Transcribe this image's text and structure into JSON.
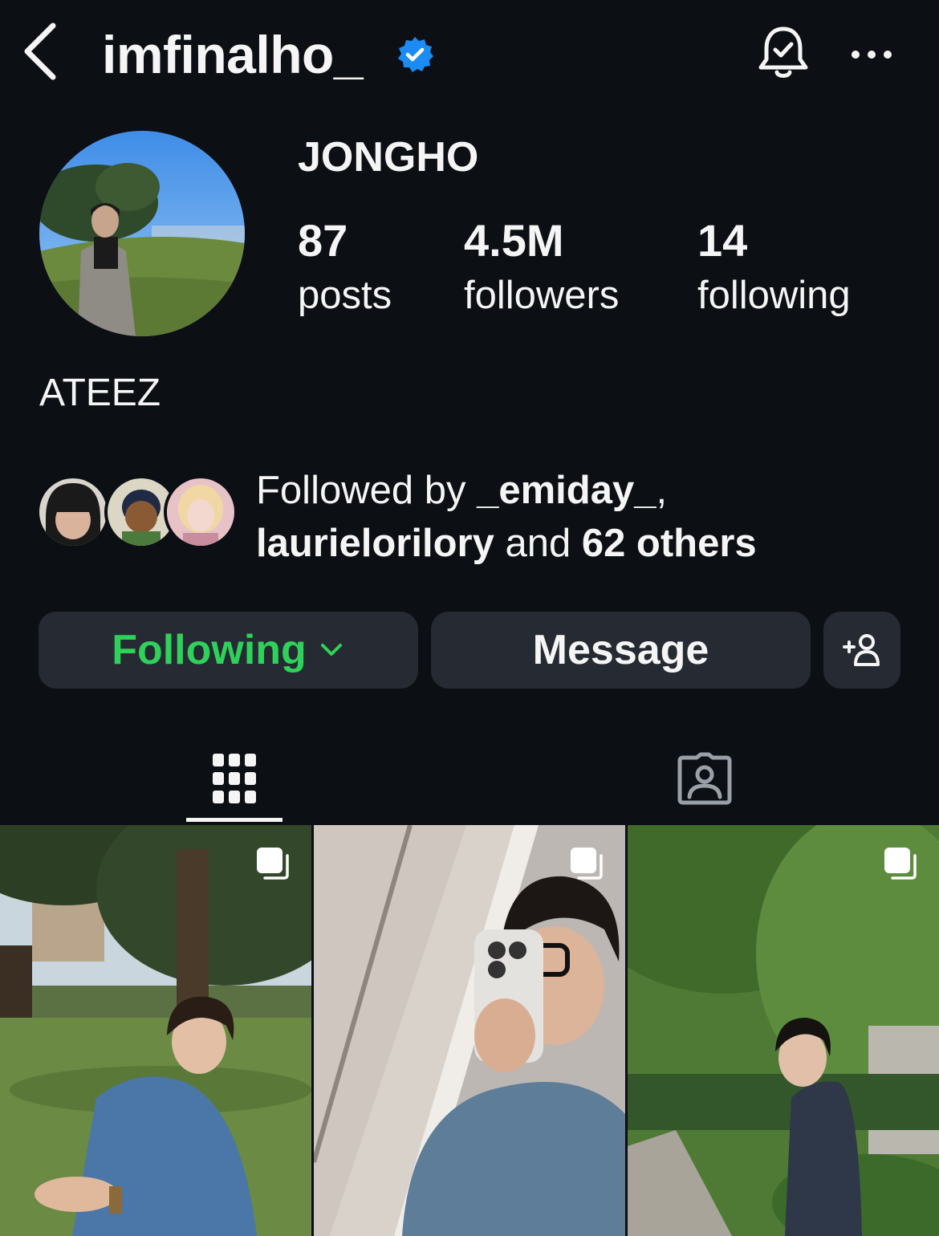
{
  "header": {
    "username": "imfinalho_",
    "verified": true,
    "icons": [
      "chevron-left-icon",
      "verified-badge-icon",
      "bell-check-icon",
      "more-icon"
    ]
  },
  "profile": {
    "display_name": "JONGHO",
    "stats": {
      "posts": {
        "count": "87",
        "label": "posts"
      },
      "followers": {
        "count": "4.5M",
        "label": "followers"
      },
      "following": {
        "count": "14",
        "label": "following"
      }
    },
    "bio": "ATEEZ"
  },
  "followed_by": {
    "prefix": "Followed by ",
    "user1": "_emiday_",
    "sep": ",",
    "user2": "laurielorilory",
    "and": " and ",
    "others": "62 others"
  },
  "actions": {
    "following_label": "Following",
    "message_label": "Message",
    "following_color": "#2ed159"
  },
  "tabs": [
    "grid-icon",
    "tagged-icon"
  ],
  "posts": [
    {
      "id": 1,
      "type": "carousel"
    },
    {
      "id": 2,
      "type": "carousel"
    },
    {
      "id": 3,
      "type": "carousel"
    }
  ],
  "colors": {
    "background": "#0c0f14",
    "button_bg": "#262a32",
    "verified_blue": "#1a8cf3"
  }
}
